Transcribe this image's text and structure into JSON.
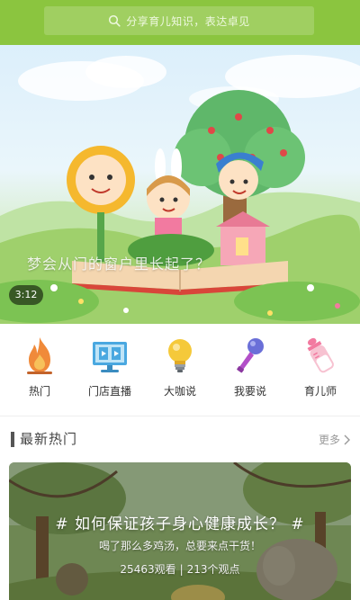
{
  "colors": {
    "header_green": "#8bc53f",
    "icon_orange": "#f08a3a",
    "icon_blue": "#4aa8e0",
    "icon_yellow": "#f5c93a",
    "icon_purple": "#b24fc8",
    "icon_pink": "#f27aa0"
  },
  "search": {
    "icon": "search-icon",
    "placeholder": "分享育儿知识，表达卓见"
  },
  "hero": {
    "caption": "梦会从门的窗户里长起了？",
    "duration": "3:12"
  },
  "categories": [
    {
      "label": "热门",
      "icon": "fire-icon"
    },
    {
      "label": "门店直播",
      "icon": "live-screen-icon"
    },
    {
      "label": "大咖说",
      "icon": "lightbulb-icon"
    },
    {
      "label": "我要说",
      "icon": "microphone-icon"
    },
    {
      "label": "育儿师",
      "icon": "baby-bottle-icon"
    }
  ],
  "section": {
    "title": "最新热门",
    "more_label": "更多"
  },
  "article": {
    "title": "# 如何保证孩子身心健康成长？ #",
    "subtitle": "喝了那么多鸡汤，总要来点干货！",
    "views": "25463观看",
    "separator": "|",
    "opinions": "213个观点"
  }
}
